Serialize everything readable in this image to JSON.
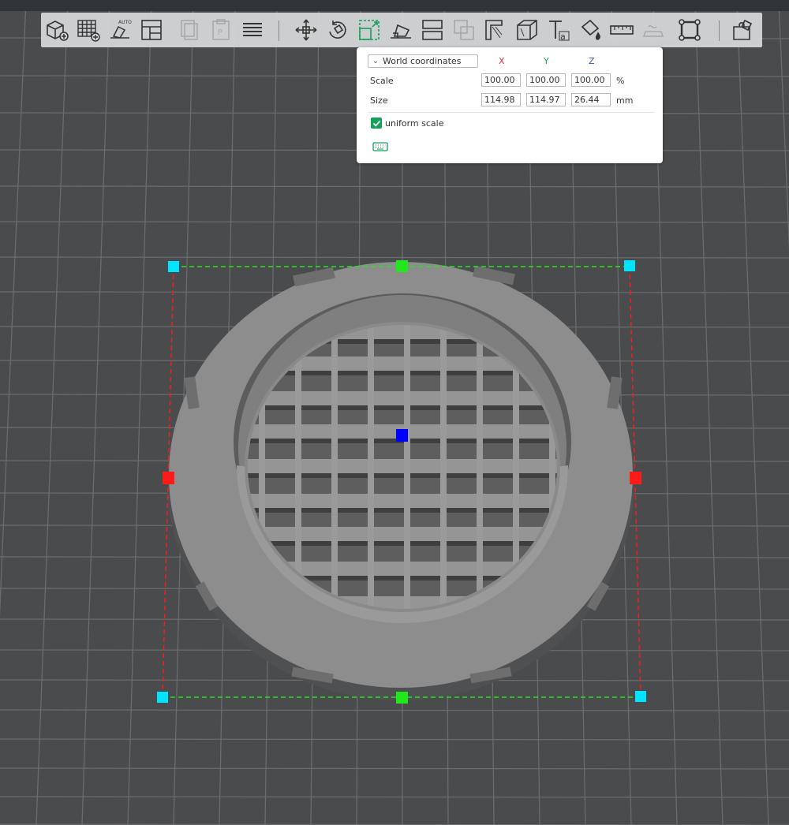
{
  "toolbar": {
    "icons": [
      "add-cube-icon",
      "arrange-grid-icon",
      "auto-orient-icon",
      "plate-layout-icon",
      "copy-icon",
      "paste-icon",
      "layers-icon",
      "move-icon",
      "rotate-icon",
      "scale-icon",
      "lay-on-face-icon",
      "split-icon",
      "boolean-icon",
      "cut-icon",
      "support-paint-icon",
      "text-emboss-icon",
      "color-paint-icon",
      "measure-icon",
      "seam-icon",
      "fit-view-icon",
      "assembly-icon"
    ]
  },
  "scale_panel": {
    "coordinate_mode": "World coordinates",
    "axes": {
      "x": "X",
      "y": "Y",
      "z": "Z"
    },
    "axis_colors": {
      "x": "#e03131",
      "y": "#22a347",
      "z": "#2b50d8"
    },
    "scale": {
      "label": "Scale",
      "x": "100.00",
      "y": "100.00",
      "z": "100.00",
      "unit": "%"
    },
    "size": {
      "label": "Size",
      "x": "114.98",
      "y": "114.97",
      "z": "26.44",
      "unit": "mm"
    },
    "uniform_scale": {
      "label": "uniform scale",
      "checked": true
    }
  },
  "colors": {
    "accent": "#12a05a",
    "background": "#4a4b4d",
    "model": "#8c8c8c",
    "handle_corner": "#00e5ff",
    "handle_x": "#ff1a1a",
    "handle_y": "#22e61e",
    "handle_center": "#0000ff"
  }
}
